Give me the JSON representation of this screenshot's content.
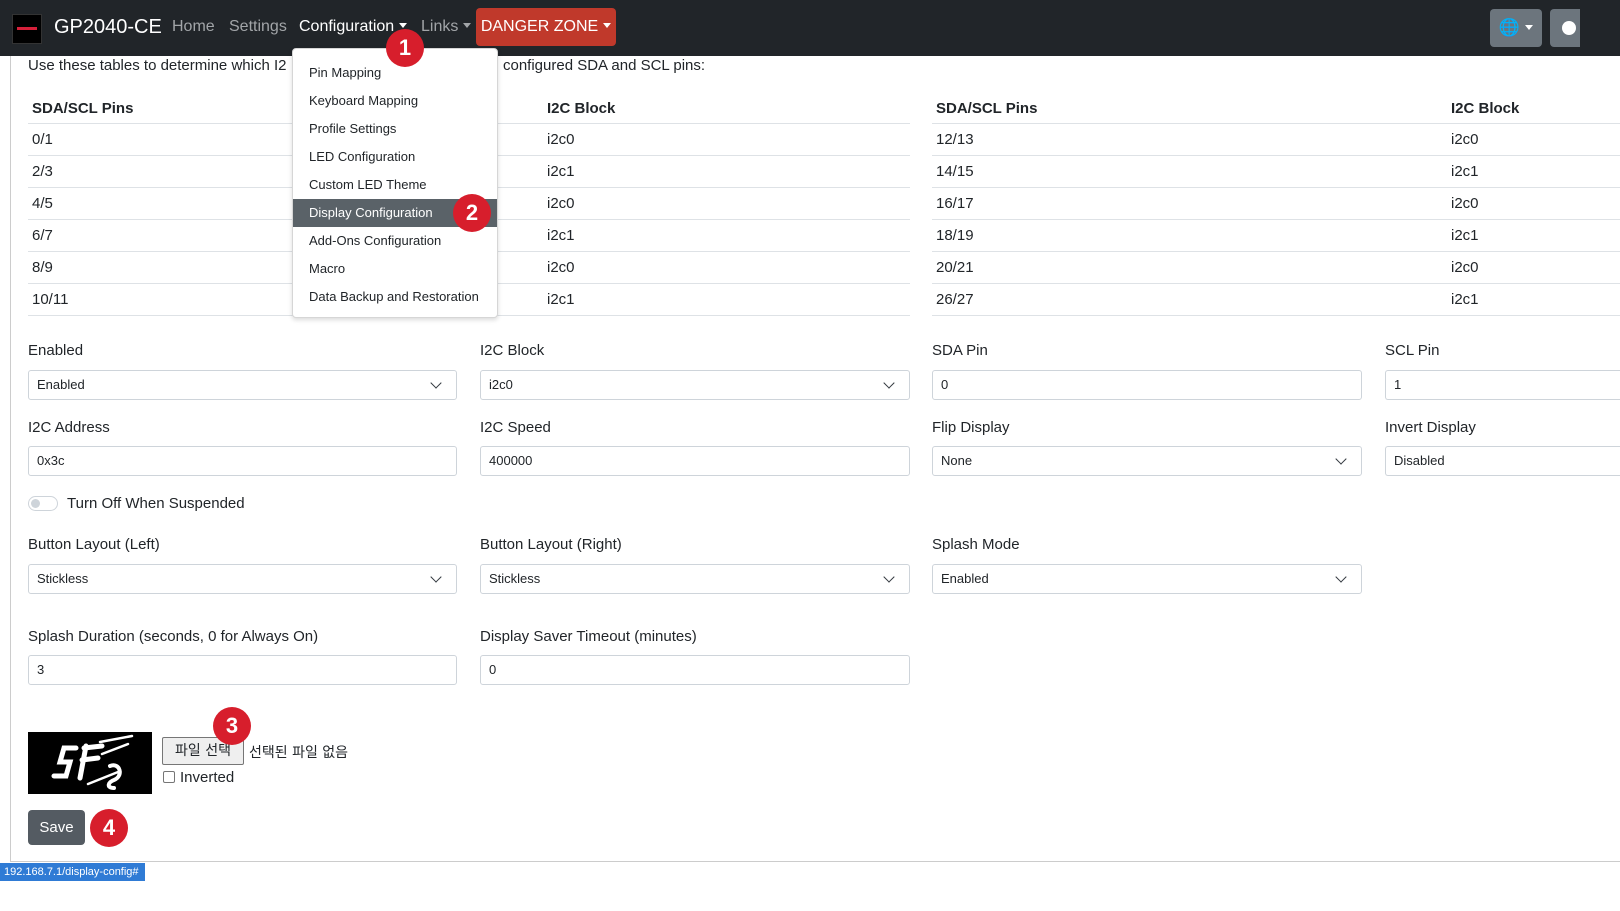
{
  "navbar": {
    "brand": "GP2040-CE",
    "home": "Home",
    "settings": "Settings",
    "configuration": "Configuration",
    "links": "Links",
    "danger_zone": "DANGER ZONE"
  },
  "config_menu": {
    "items": [
      "Pin Mapping",
      "Keyboard Mapping",
      "Profile Settings",
      "LED Configuration",
      "Custom LED Theme",
      "Display Configuration",
      "Add-Ons Configuration",
      "Macro",
      "Data Backup and Restoration"
    ],
    "active_index": 5
  },
  "intro": {
    "part1": "Use these tables to determine which I2",
    "part2": "configured SDA and SCL pins:"
  },
  "pin_table_left": {
    "headers": [
      "SDA/SCL Pins",
      "I2C Block"
    ],
    "rows": [
      [
        "0/1",
        "i2c0"
      ],
      [
        "2/3",
        "i2c1"
      ],
      [
        "4/5",
        "i2c0"
      ],
      [
        "6/7",
        "i2c1"
      ],
      [
        "8/9",
        "i2c0"
      ],
      [
        "10/11",
        "i2c1"
      ]
    ]
  },
  "pin_table_right": {
    "headers": [
      "SDA/SCL Pins",
      "I2C Block"
    ],
    "rows": [
      [
        "12/13",
        "i2c0"
      ],
      [
        "14/15",
        "i2c1"
      ],
      [
        "16/17",
        "i2c0"
      ],
      [
        "18/19",
        "i2c1"
      ],
      [
        "20/21",
        "i2c0"
      ],
      [
        "26/27",
        "i2c1"
      ]
    ]
  },
  "form": {
    "enabled": {
      "label": "Enabled",
      "value": "Enabled"
    },
    "i2c_block": {
      "label": "I2C Block",
      "value": "i2c0"
    },
    "sda_pin": {
      "label": "SDA Pin",
      "value": "0"
    },
    "scl_pin": {
      "label": "SCL Pin",
      "value": "1"
    },
    "i2c_address": {
      "label": "I2C Address",
      "value": "0x3c"
    },
    "i2c_speed": {
      "label": "I2C Speed",
      "value": "400000"
    },
    "flip_display": {
      "label": "Flip Display",
      "value": "None"
    },
    "invert_display": {
      "label": "Invert Display",
      "value": "Disabled"
    },
    "turn_off_suspended": {
      "label": "Turn Off When Suspended"
    },
    "button_layout_left": {
      "label": "Button Layout (Left)",
      "value": "Stickless"
    },
    "button_layout_right": {
      "label": "Button Layout (Right)",
      "value": "Stickless"
    },
    "splash_mode": {
      "label": "Splash Mode",
      "value": "Enabled"
    },
    "splash_duration": {
      "label": "Splash Duration (seconds, 0 for Always On)",
      "value": "3"
    },
    "display_saver": {
      "label": "Display Saver Timeout (minutes)",
      "value": "0"
    }
  },
  "splash": {
    "file_button": "파일 선택",
    "file_status": "선택된 파일 없음",
    "inverted_label": "Inverted"
  },
  "save_label": "Save",
  "status_url": "192.168.7.1/display-config#",
  "badges": [
    "1",
    "2",
    "3",
    "4"
  ],
  "colors": {
    "navbar_bg": "#212529",
    "danger": "#c0392b",
    "badge": "#d71e2c",
    "save_bg": "#545b62",
    "menu_active_bg": "#5a6268"
  },
  "icons": {
    "globe": "globe-icon",
    "dropdown": "caret-down-icon",
    "select": "chevron-down-icon"
  }
}
